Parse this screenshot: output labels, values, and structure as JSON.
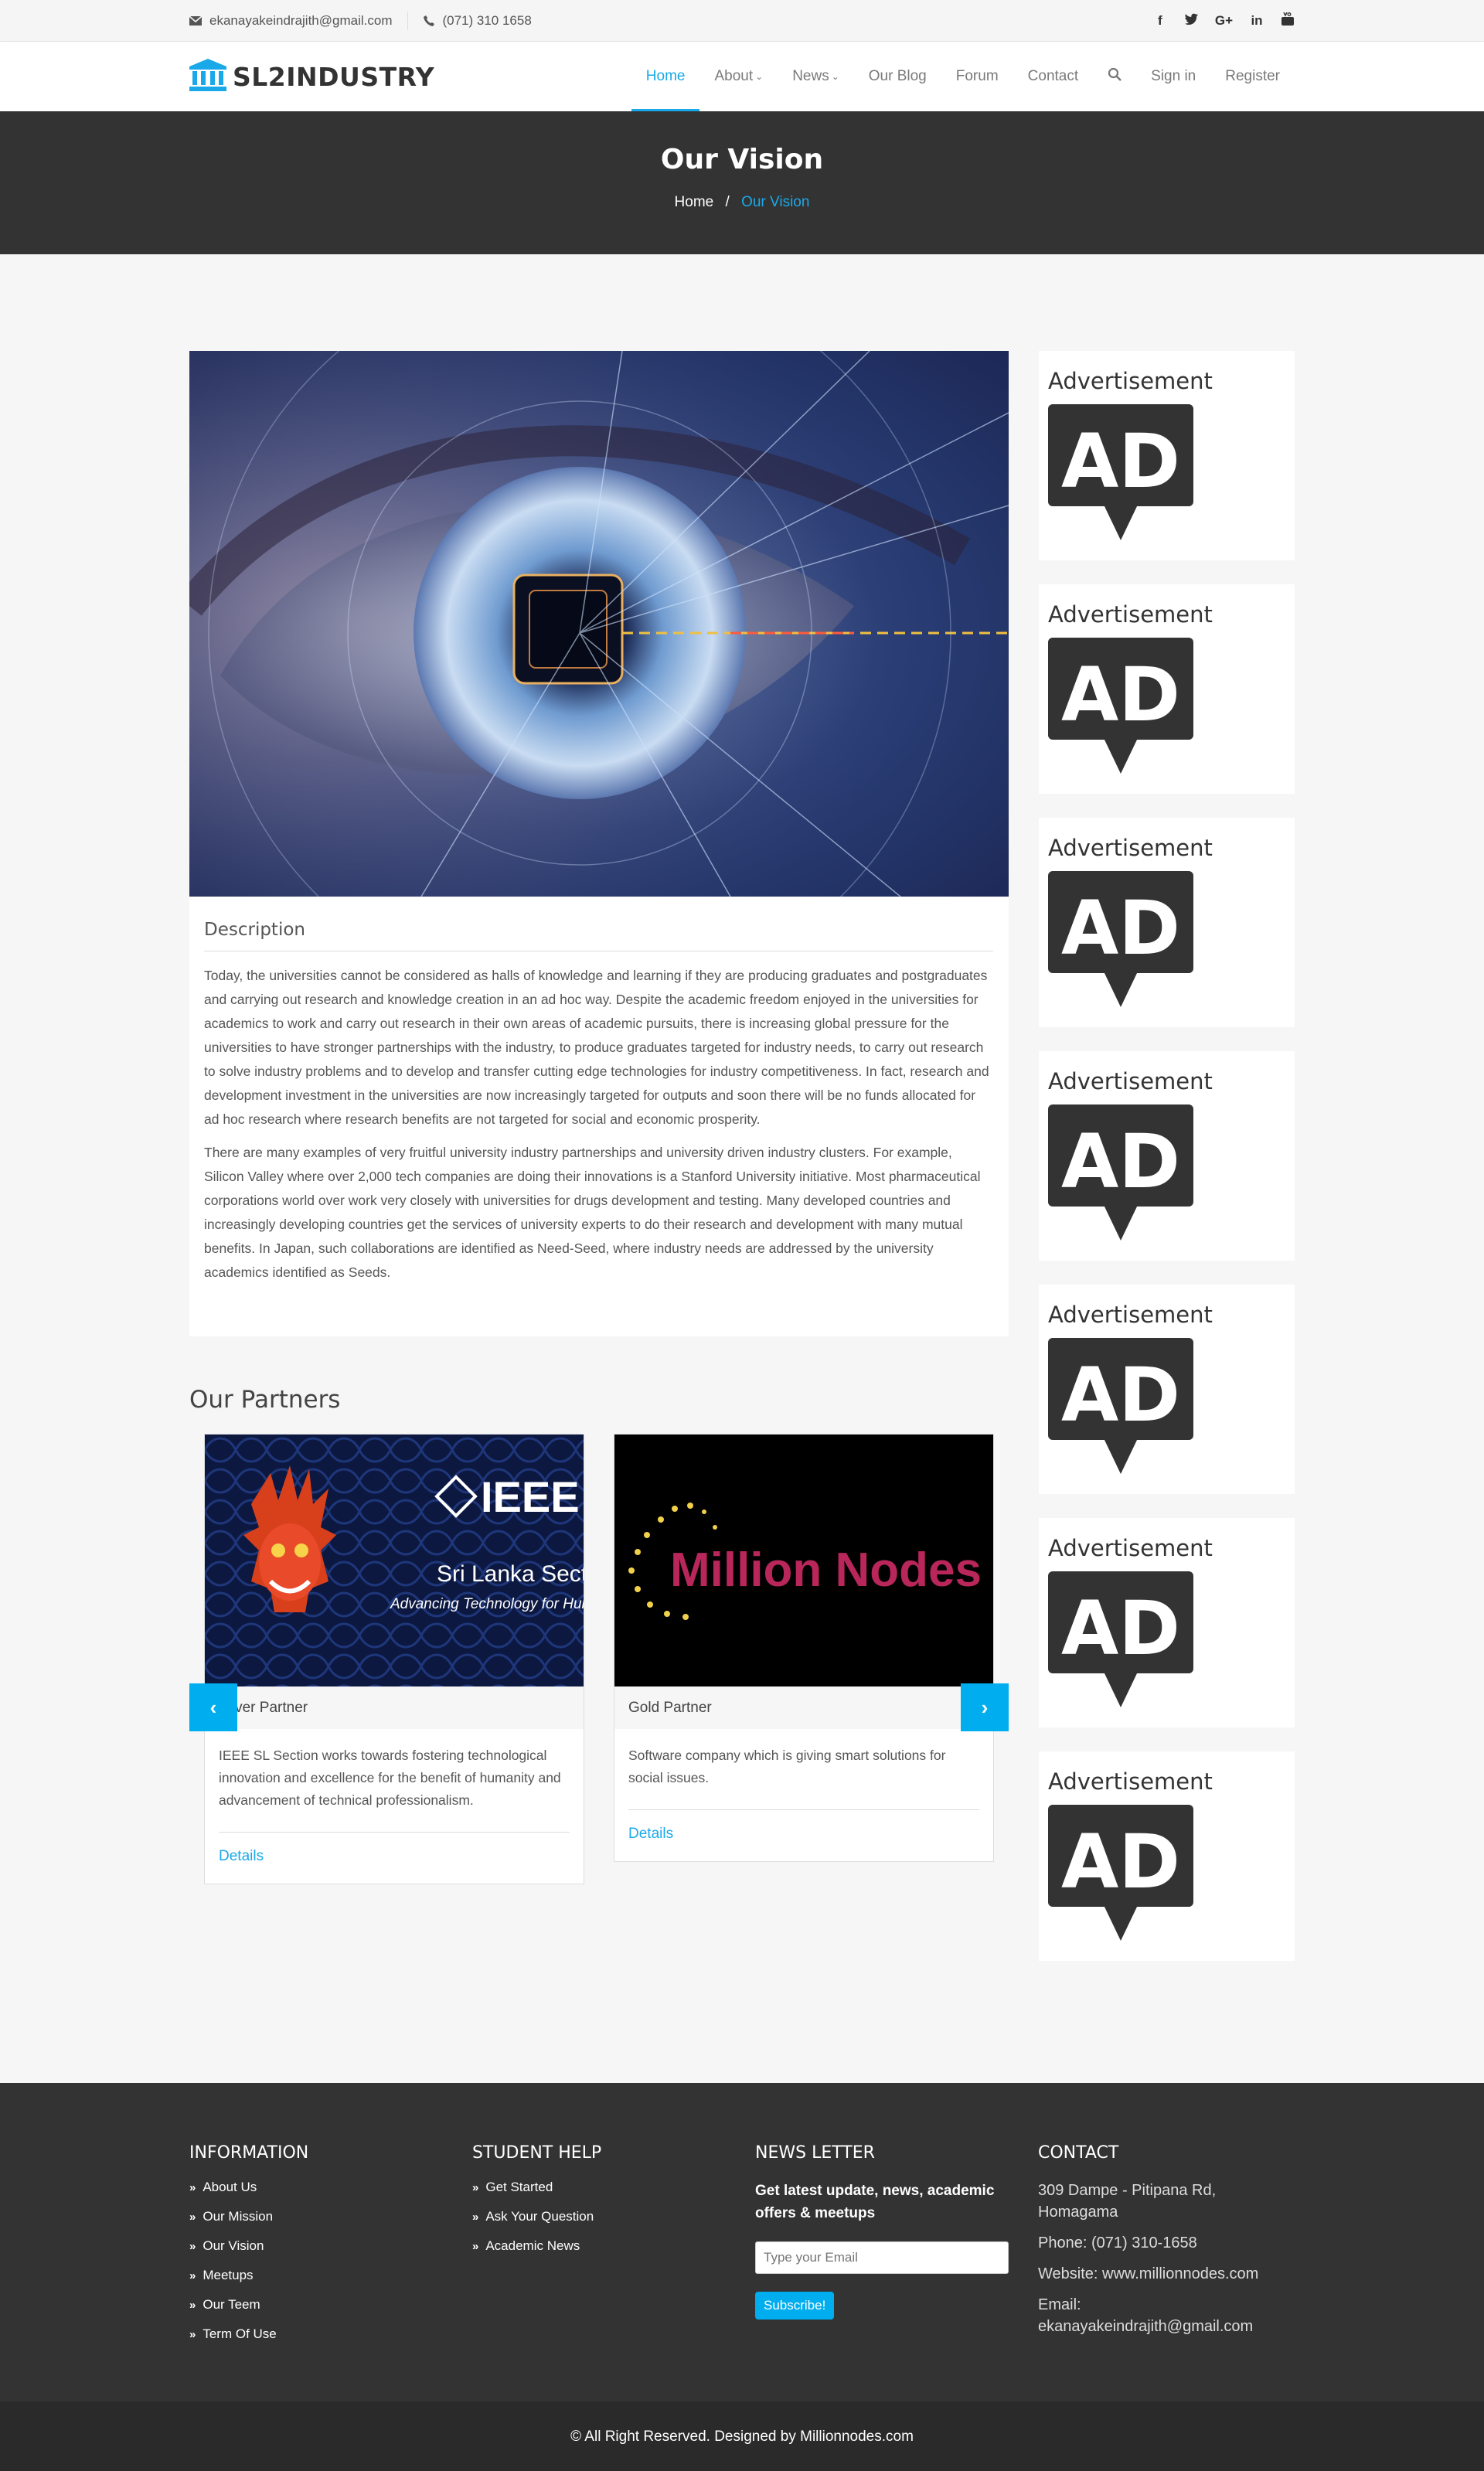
{
  "topbar": {
    "email": "ekanayakeindrajith@gmail.com",
    "phone": "(071) 310 1658",
    "social_icons": [
      "facebook-icon",
      "twitter-icon",
      "google-plus-icon",
      "linkedin-icon",
      "youtube-icon"
    ]
  },
  "brand": {
    "name": "SL2INDUSTRY",
    "color": "#1aa9e8"
  },
  "nav": {
    "home": "Home",
    "about": "About",
    "news": "News",
    "blog": "Our Blog",
    "forum": "Forum",
    "contact": "Contact",
    "signin": "Sign in",
    "register": "Register"
  },
  "page_header": {
    "title": "Our Vision",
    "crumb_home": "Home",
    "crumb_sep": "/",
    "crumb_current": "Our Vision"
  },
  "description": {
    "heading": "Description",
    "p1": "Today, the universities cannot be considered as halls of knowledge and learning if they are producing graduates and postgraduates and carrying out research and knowledge creation in an ad hoc way. Despite the academic freedom enjoyed in the universities for academics to work and carry out research in their own areas of academic pursuits, there is increasing global pressure for the universities to have stronger partnerships with the industry, to produce graduates targeted for industry needs, to carry out research to solve industry problems and to develop and transfer cutting edge technologies for industry competitiveness. In fact, research and development investment in the universities are now increasingly targeted for outputs and soon there will be no funds allocated for ad hoc research where research benefits are not targeted for social and economic prosperity.",
    "p2": "There are many examples of very fruitful university industry partnerships and university driven industry clusters. For example, Silicon Valley where over 2,000 tech companies are doing their innovations is a Stanford University initiative. Most pharmaceutical corporations world over work very closely with universities for drugs development and testing. Many developed countries and increasingly developing countries get the services of university experts to do their research and development with many mutual benefits. In Japan, such collaborations are identified as Need-Seed, where industry needs are addressed by the university academics identified as Seeds."
  },
  "partners": {
    "title": "Our Partners",
    "items": [
      {
        "logo_title": "IEEE",
        "logo_sub": "Sri Lanka Section",
        "logo_tag": "Advancing Technology for Humanity",
        "type": "Silver Partner",
        "text": "IEEE SL Section works towards fostering technological innovation and excellence for the benefit of humanity and advancement of technical professionalism.",
        "link": "Details"
      },
      {
        "logo_title": "Million Nodes",
        "type": "Gold Partner",
        "text": "Software company which is giving smart solutions for social issues.",
        "link": "Details"
      }
    ],
    "prev": "‹",
    "next": "›"
  },
  "ads": [
    {
      "title": "Advertisement",
      "badge": "AD"
    },
    {
      "title": "Advertisement",
      "badge": "AD"
    },
    {
      "title": "Advertisement",
      "badge": "AD"
    },
    {
      "title": "Advertisement",
      "badge": "AD"
    },
    {
      "title": "Advertisement",
      "badge": "AD"
    },
    {
      "title": "Advertisement",
      "badge": "AD"
    },
    {
      "title": "Advertisement",
      "badge": "AD"
    }
  ],
  "footer": {
    "information": {
      "title": "INFORMATION",
      "links": [
        "About Us",
        "Our Mission",
        "Our Vision",
        "Meetups",
        "Our Teem",
        "Term Of Use"
      ]
    },
    "student_help": {
      "title": "STUDENT HELP",
      "links": [
        "Get Started",
        "Ask Your Question",
        "Academic News"
      ]
    },
    "newsletter": {
      "title": "NEWS LETTER",
      "text": "Get latest update, news, academic offers & meetups",
      "placeholder": "Type your Email",
      "button": "Subscribe!"
    },
    "contact": {
      "title": "CONTACT",
      "address": "309 Dampe - Pitipana Rd, Homagama",
      "phone": "Phone: (071) 310-1658",
      "website": "Website: www.millionnodes.com",
      "email": "Email: ekanayakeindrajith@gmail.com"
    },
    "copyright": "© All Right Reserved. Designed by Millionnodes.com"
  }
}
